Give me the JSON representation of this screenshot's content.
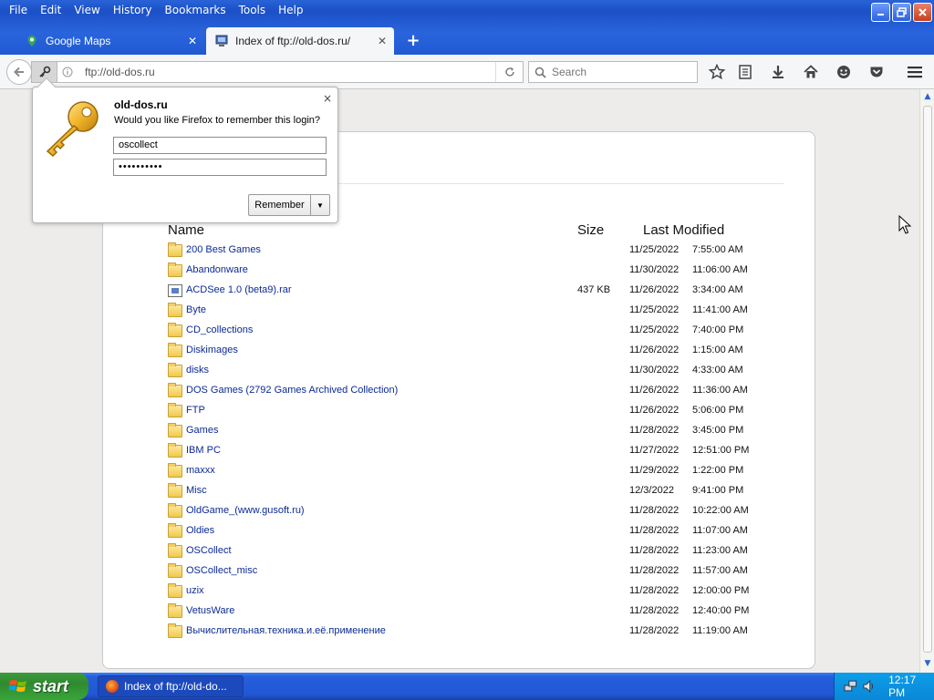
{
  "menu": [
    {
      "label": "File"
    },
    {
      "label": "Edit"
    },
    {
      "label": "View"
    },
    {
      "label": "History"
    },
    {
      "label": "Bookmarks"
    },
    {
      "label": "Tools"
    },
    {
      "label": "Help"
    }
  ],
  "tabs": [
    {
      "label": "Google Maps",
      "active": false
    },
    {
      "label": "Index of ftp://old-dos.ru/",
      "active": true
    }
  ],
  "navbar": {
    "url": "ftp://old-dos.ru",
    "search_placeholder": "Search"
  },
  "doorhanger": {
    "site": "old-dos.ru",
    "question": "Would you like Firefox to remember this login?",
    "username": "oscollect",
    "password": "••••••••••",
    "remember_label": "Remember",
    "close_glyph": "×"
  },
  "listing": {
    "columns": {
      "name": "Name",
      "size": "Size",
      "modified": "Last Modified"
    },
    "rows": [
      {
        "name": "200 Best Games",
        "type": "folder",
        "size": "",
        "date": "11/25/2022",
        "time": "7:55:00 AM"
      },
      {
        "name": "Abandonware",
        "type": "folder",
        "size": "",
        "date": "11/30/2022",
        "time": "11:06:00 AM"
      },
      {
        "name": "ACDSee 1.0 (beta9).rar",
        "type": "file",
        "size": "437 KB",
        "date": "11/26/2022",
        "time": "3:34:00 AM"
      },
      {
        "name": "Byte",
        "type": "folder",
        "size": "",
        "date": "11/25/2022",
        "time": "11:41:00 AM"
      },
      {
        "name": "CD_collections",
        "type": "folder",
        "size": "",
        "date": "11/25/2022",
        "time": "7:40:00 PM"
      },
      {
        "name": "Diskimages",
        "type": "folder",
        "size": "",
        "date": "11/26/2022",
        "time": "1:15:00 AM"
      },
      {
        "name": "disks",
        "type": "folder",
        "size": "",
        "date": "11/30/2022",
        "time": "4:33:00 AM"
      },
      {
        "name": "DOS Games (2792 Games Archived Collection)",
        "type": "folder",
        "size": "",
        "date": "11/26/2022",
        "time": "11:36:00 AM"
      },
      {
        "name": "FTP",
        "type": "folder",
        "size": "",
        "date": "11/26/2022",
        "time": "5:06:00 PM"
      },
      {
        "name": "Games",
        "type": "folder",
        "size": "",
        "date": "11/28/2022",
        "time": "3:45:00 PM"
      },
      {
        "name": "IBM PC",
        "type": "folder",
        "size": "",
        "date": "11/27/2022",
        "time": "12:51:00 PM"
      },
      {
        "name": "maxxx",
        "type": "folder",
        "size": "",
        "date": "11/29/2022",
        "time": "1:22:00 PM"
      },
      {
        "name": "Misc",
        "type": "folder",
        "size": "",
        "date": "12/3/2022",
        "time": "9:41:00 PM"
      },
      {
        "name": "OldGame_(www.gusoft.ru)",
        "type": "folder",
        "size": "",
        "date": "11/28/2022",
        "time": "10:22:00 AM"
      },
      {
        "name": "Oldies",
        "type": "folder",
        "size": "",
        "date": "11/28/2022",
        "time": "11:07:00 AM"
      },
      {
        "name": "OSCollect",
        "type": "folder",
        "size": "",
        "date": "11/28/2022",
        "time": "11:23:00 AM"
      },
      {
        "name": "OSCollect_misc",
        "type": "folder",
        "size": "",
        "date": "11/28/2022",
        "time": "11:57:00 AM"
      },
      {
        "name": "uzix",
        "type": "folder",
        "size": "",
        "date": "11/28/2022",
        "time": "12:00:00 PM"
      },
      {
        "name": "VetusWare",
        "type": "folder",
        "size": "",
        "date": "11/28/2022",
        "time": "12:40:00 PM"
      },
      {
        "name": "Вычислительная.техника.и.её.применение",
        "type": "folder",
        "size": "",
        "date": "11/28/2022",
        "time": "11:19:00 AM"
      }
    ]
  },
  "taskbar": {
    "start_label": "start",
    "task_label": "Index of ftp://old-do...",
    "clock": "12:17 PM"
  },
  "colors": {
    "xp_blue": "#245edb",
    "start_green": "#3c9b3c",
    "link_blue": "#0b2a95",
    "folder_yellow": "#f1c94b"
  }
}
